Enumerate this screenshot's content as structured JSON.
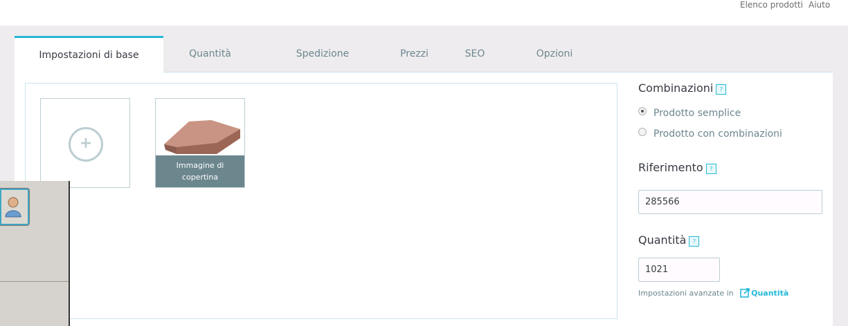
{
  "top_links": {
    "elenco": "Elenco prodotti",
    "aiuto": "Aiuto"
  },
  "tabs": [
    {
      "label": "Impostazioni di base",
      "active": true
    },
    {
      "label": "Quantità"
    },
    {
      "label": "Spedizione"
    },
    {
      "label": "Prezzi"
    },
    {
      "label": "SEO"
    },
    {
      "label": "Opzioni"
    }
  ],
  "images": {
    "add_icon": "plus-circle-icon",
    "cover_caption_line1": "Immagine di",
    "cover_caption_line2": "copertina"
  },
  "combinazioni": {
    "title": "Combinazioni",
    "help": "?",
    "options": [
      {
        "label": "Prodotto semplice",
        "selected": true
      },
      {
        "label": "Prodotto con combinazioni",
        "selected": false
      }
    ]
  },
  "riferimento": {
    "title": "Riferimento",
    "help": "?",
    "value": "285566"
  },
  "quantita": {
    "title": "Quantità",
    "help": "?",
    "value": "1021",
    "advanced_text": "Impostazioni avanzate in",
    "advanced_link": "Quantità"
  },
  "colors": {
    "accent": "#25b9d7",
    "caption_bg": "#6c868e",
    "border": "#bbcdd2"
  }
}
